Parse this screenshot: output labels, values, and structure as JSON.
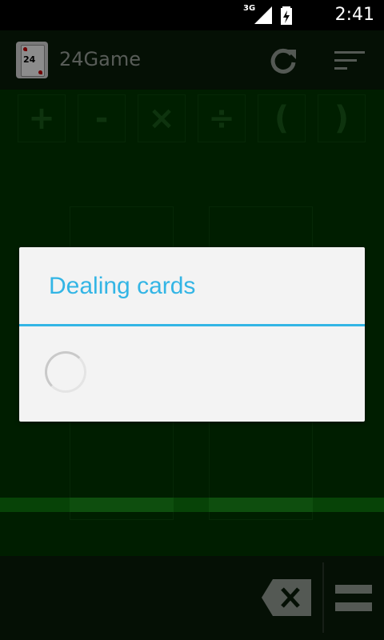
{
  "status_bar": {
    "network": "3G",
    "time": "2:41"
  },
  "action_bar": {
    "app_title": "24Game",
    "app_icon_card": "24"
  },
  "operators": [
    {
      "label": "+"
    },
    {
      "label": "-"
    },
    {
      "label": "×"
    },
    {
      "label": "÷"
    },
    {
      "label": "("
    },
    {
      "label": ")"
    }
  ],
  "dialog": {
    "title": "Dealing cards"
  },
  "colors": {
    "accent": "#33b5e5",
    "table_green": "#003800",
    "bar_green": "#0d7a0d"
  }
}
